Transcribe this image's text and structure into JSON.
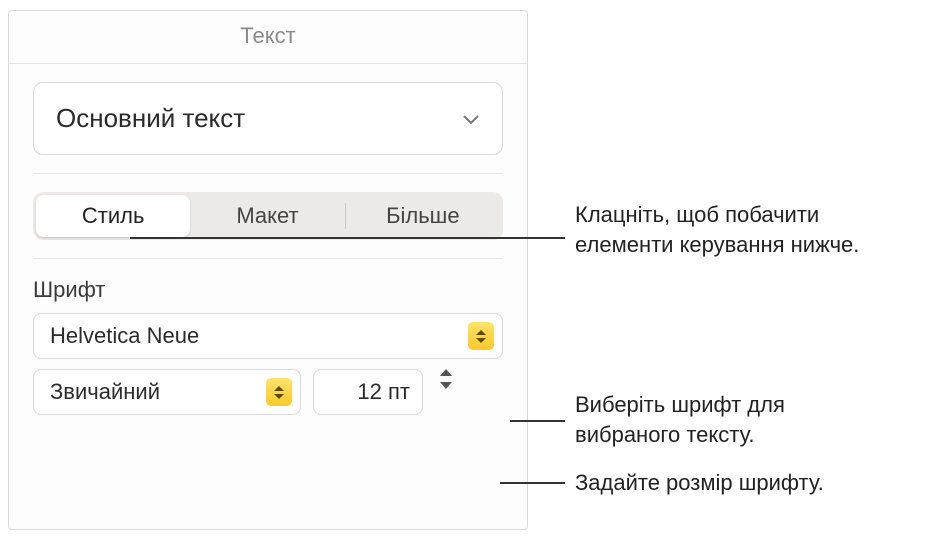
{
  "panel": {
    "title": "Текст",
    "paragraphStyle": "Основний текст"
  },
  "tabs": {
    "style": "Стиль",
    "layout": "Макет",
    "more": "Більше"
  },
  "font": {
    "sectionLabel": "Шрифт",
    "family": "Helvetica Neue",
    "weight": "Звичайний",
    "size": "12 пт"
  },
  "callouts": {
    "tabs": "Клацніть, щоб побачити елементи керування нижче.",
    "fontSelect": "Виберіть шрифт для вибраного тексту.",
    "fontSize": "Задайте розмір шрифту."
  }
}
